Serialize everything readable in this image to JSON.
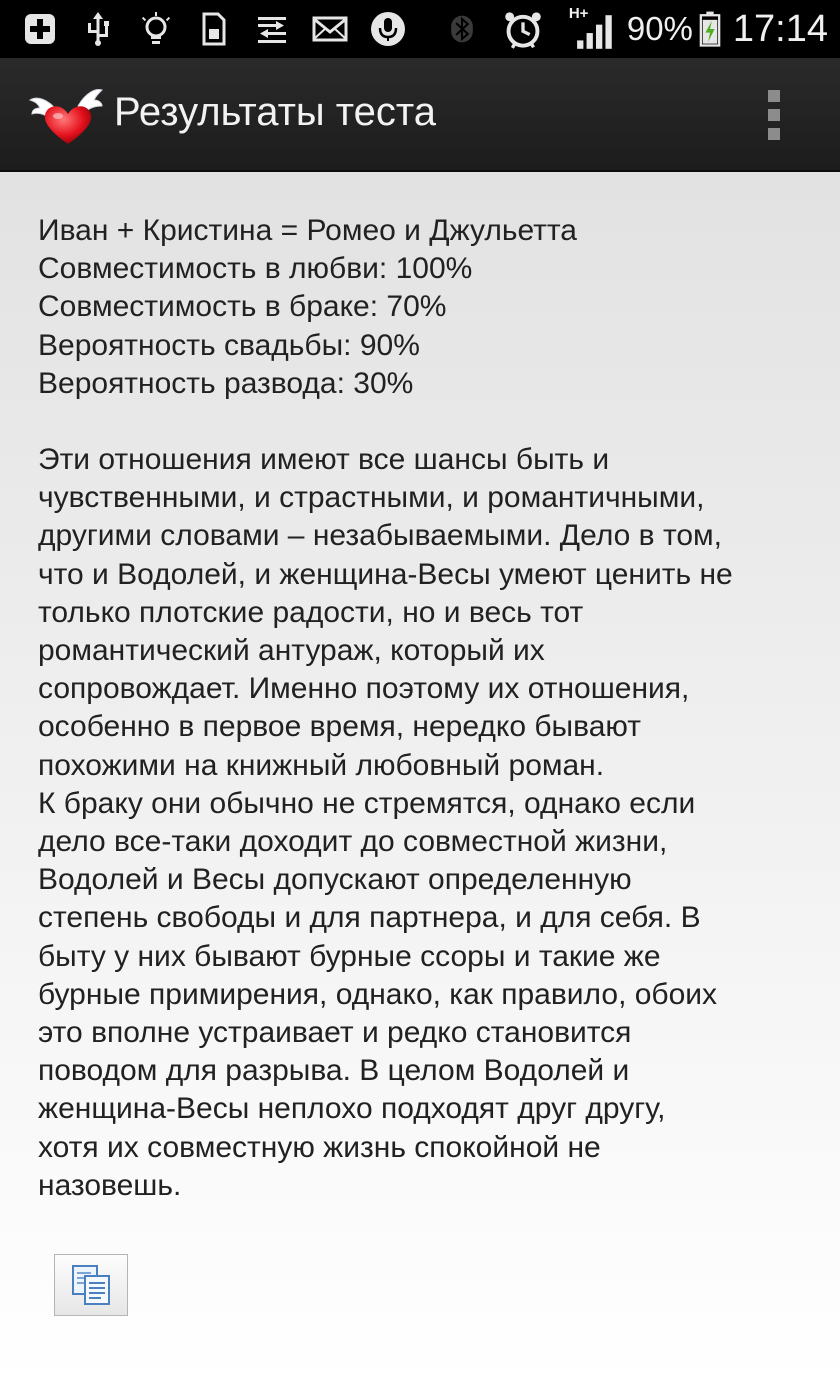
{
  "status_bar": {
    "battery_percent": "90%",
    "clock": "17:14",
    "network_label": "H+",
    "left_icons": [
      "add-icon",
      "usb-icon",
      "lightbulb-icon",
      "sim-icon",
      "data-transfer-icon",
      "email-icon",
      "microphone-icon"
    ],
    "right_icons": [
      "bluetooth-icon",
      "alarm-icon",
      "signal-icon",
      "battery-charging-icon"
    ]
  },
  "action_bar": {
    "title": "Результаты теста",
    "logo_icon": "winged-heart-icon",
    "overflow_icon": "overflow-menu-icon"
  },
  "results": {
    "match_line": "Иван  + Кристина  = Ромео и Джульетта",
    "love_compatibility": "Совместимость в любви: 100%",
    "marriage_compatibility": "Совместимость в браке: 70%",
    "wedding_probability": "Вероятность свадьбы: 90%",
    "divorce_probability": "Вероятность развода: 30%"
  },
  "description": "Эти отношения имеют все шансы быть и\nчувственными, и страстными, и романтичными,\nдругими словами – незабываемыми. Дело в том,\nчто и Водолей, и женщина-Весы умеют ценить не\nтолько плотские радости, но и весь тот\nромантический антураж, который их\nсопровождает. Именно поэтому их отношения,\nособенно в первое время, нередко бывают\nпохожими на книжный любовный роман.\nК браку они обычно не стремятся, однако если\nдело все-таки доходит до совместной жизни,\nВодолей и Весы допускают определенную\nстепень свободы и для партнера, и для себя. В\nбыту у них бывают бурные ссоры и такие же\nбурные примирения, однако, как правило, обоих\nэто вполне устраивает и редко становится\nповодом для разрыва. В целом Водолей и\nженщина-Весы неплохо подходят друг другу,\nхотя их совместную жизнь спокойной не\nназовешь.",
  "copy_button": {
    "icon": "copy-icon"
  }
}
